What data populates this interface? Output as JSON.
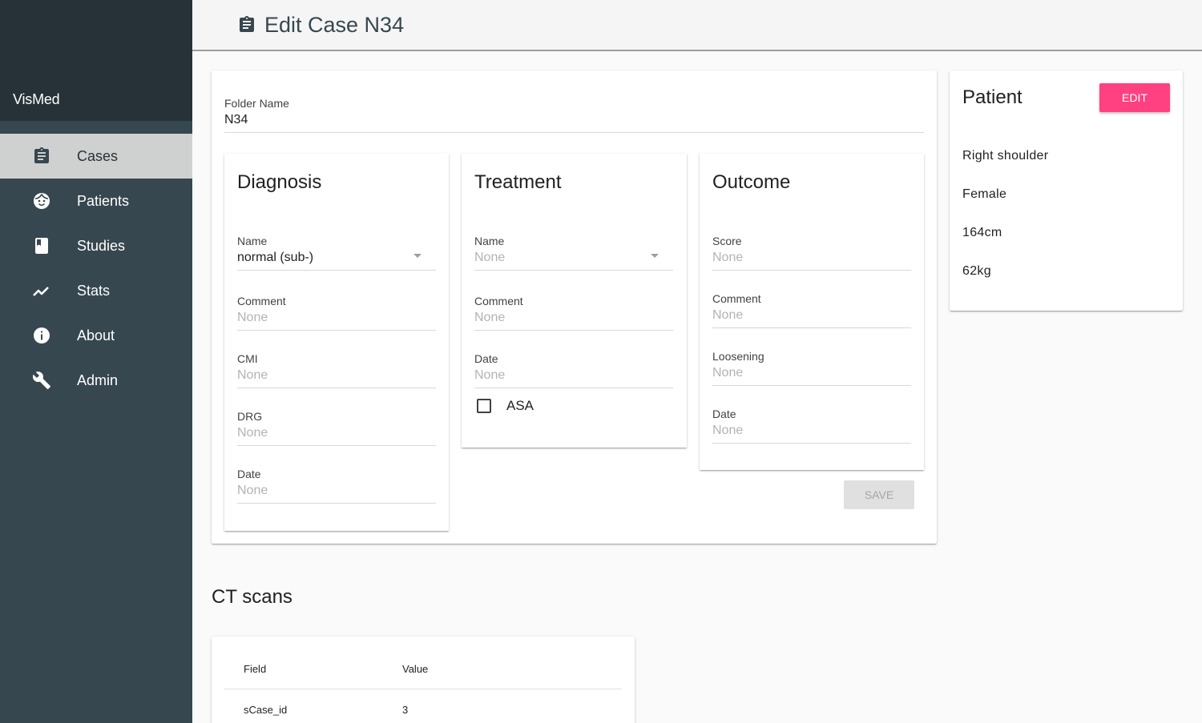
{
  "app": {
    "name": "VisMed"
  },
  "sidebar": {
    "items": [
      {
        "label": "Cases",
        "icon": "clipboard-icon",
        "active": true
      },
      {
        "label": "Patients",
        "icon": "face-icon",
        "active": false
      },
      {
        "label": "Studies",
        "icon": "book-icon",
        "active": false
      },
      {
        "label": "Stats",
        "icon": "trending-icon",
        "active": false
      },
      {
        "label": "About",
        "icon": "info-icon",
        "active": false
      },
      {
        "label": "Admin",
        "icon": "wrench-icon",
        "active": false
      }
    ]
  },
  "header": {
    "title": "Edit Case N34",
    "icon": "clipboard-icon"
  },
  "form": {
    "folder_name": {
      "label": "Folder Name",
      "value": "N34"
    },
    "diagnosis": {
      "title": "Diagnosis",
      "name": {
        "label": "Name",
        "value": "normal (sub-)"
      },
      "comment": {
        "label": "Comment",
        "placeholder": "None"
      },
      "cmi": {
        "label": "CMI",
        "placeholder": "None"
      },
      "drg": {
        "label": "DRG",
        "placeholder": "None"
      },
      "date": {
        "label": "Date",
        "placeholder": "None"
      }
    },
    "treatment": {
      "title": "Treatment",
      "name": {
        "label": "Name",
        "placeholder": "None"
      },
      "comment": {
        "label": "Comment",
        "placeholder": "None"
      },
      "date": {
        "label": "Date",
        "placeholder": "None"
      },
      "asa": {
        "label": "ASA",
        "checked": false
      }
    },
    "outcome": {
      "title": "Outcome",
      "score": {
        "label": "Score",
        "placeholder": "None"
      },
      "comment": {
        "label": "Comment",
        "placeholder": "None"
      },
      "loosening": {
        "label": "Loosening",
        "placeholder": "None"
      },
      "date": {
        "label": "Date",
        "placeholder": "None"
      }
    },
    "save_label": "SAVE"
  },
  "patient": {
    "title": "Patient",
    "edit_label": "EDIT",
    "side": "Right shoulder",
    "sex": "Female",
    "height": "164cm",
    "weight": "62kg"
  },
  "ct_scans": {
    "title": "CT scans",
    "columns": [
      "Field",
      "Value"
    ],
    "rows": [
      {
        "field": "sCase_id",
        "value": "3"
      }
    ]
  },
  "colors": {
    "sidebar": "#37474f",
    "sidebar_head": "#263238",
    "active_item": "#cfd0d0",
    "accent": "#ff4081"
  }
}
